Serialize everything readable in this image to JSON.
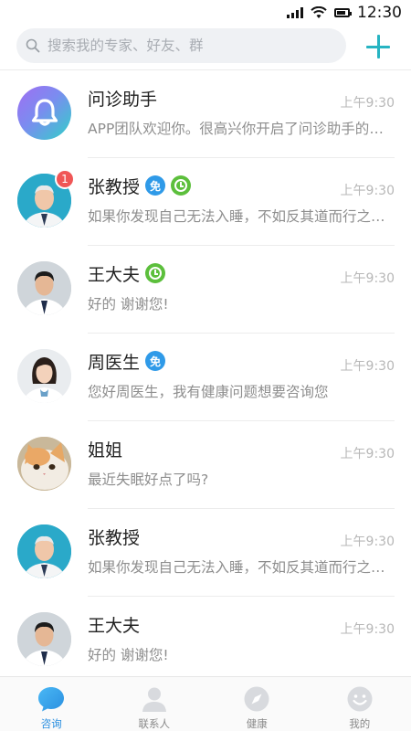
{
  "status_bar": {
    "time": "12:30"
  },
  "search": {
    "placeholder": "搜索我的专家、好友、群"
  },
  "chats": [
    {
      "name": "问诊助手",
      "message": "APP团队欢迎你。很高兴你开启了问诊助手的服务",
      "time": "上午9:30",
      "avatar": "bell-avatar",
      "tags": [],
      "unread": null
    },
    {
      "name": "张教授",
      "message": "如果你发现自己无法入睡，不如反其道而行之，保持清醒",
      "time": "上午9:30",
      "avatar": "doctor-avatar",
      "tags": [
        "免",
        "clock"
      ],
      "unread": "1"
    },
    {
      "name": "王大夫",
      "message": "好的 谢谢您!",
      "time": "上午9:30",
      "avatar": "doctor-avatar",
      "tags": [
        "clock"
      ],
      "unread": null
    },
    {
      "name": "周医生",
      "message": "您好周医生，我有健康问题想要咨询您",
      "time": "上午9:30",
      "avatar": "doctor-avatar",
      "tags": [
        "免"
      ],
      "unread": null
    },
    {
      "name": "姐姐",
      "message": "最近失眠好点了吗?",
      "time": "上午9:30",
      "avatar": "cat-avatar",
      "tags": [],
      "unread": null
    },
    {
      "name": "张教授",
      "message": "如果你发现自己无法入睡，不如反其道而行之，保持清醒",
      "time": "上午9:30",
      "avatar": "doctor-avatar",
      "tags": [],
      "unread": null
    },
    {
      "name": "王大夫",
      "message": "好的 谢谢您!",
      "time": "上午9:30",
      "avatar": "doctor-avatar",
      "tags": [],
      "unread": null
    }
  ],
  "tabs": [
    {
      "label": "咨询",
      "icon": "chat-bubble-icon",
      "active": true
    },
    {
      "label": "联系人",
      "icon": "contacts-icon",
      "active": false
    },
    {
      "label": "健康",
      "icon": "compass-icon",
      "active": false
    },
    {
      "label": "我的",
      "icon": "profile-icon",
      "active": false
    }
  ],
  "colors": {
    "accent": "#27b4c2",
    "tab_active": "#2a8fe0",
    "unread": "#f05656",
    "tag_free": "#2f9ae8",
    "tag_clock": "#5cbf3c"
  }
}
